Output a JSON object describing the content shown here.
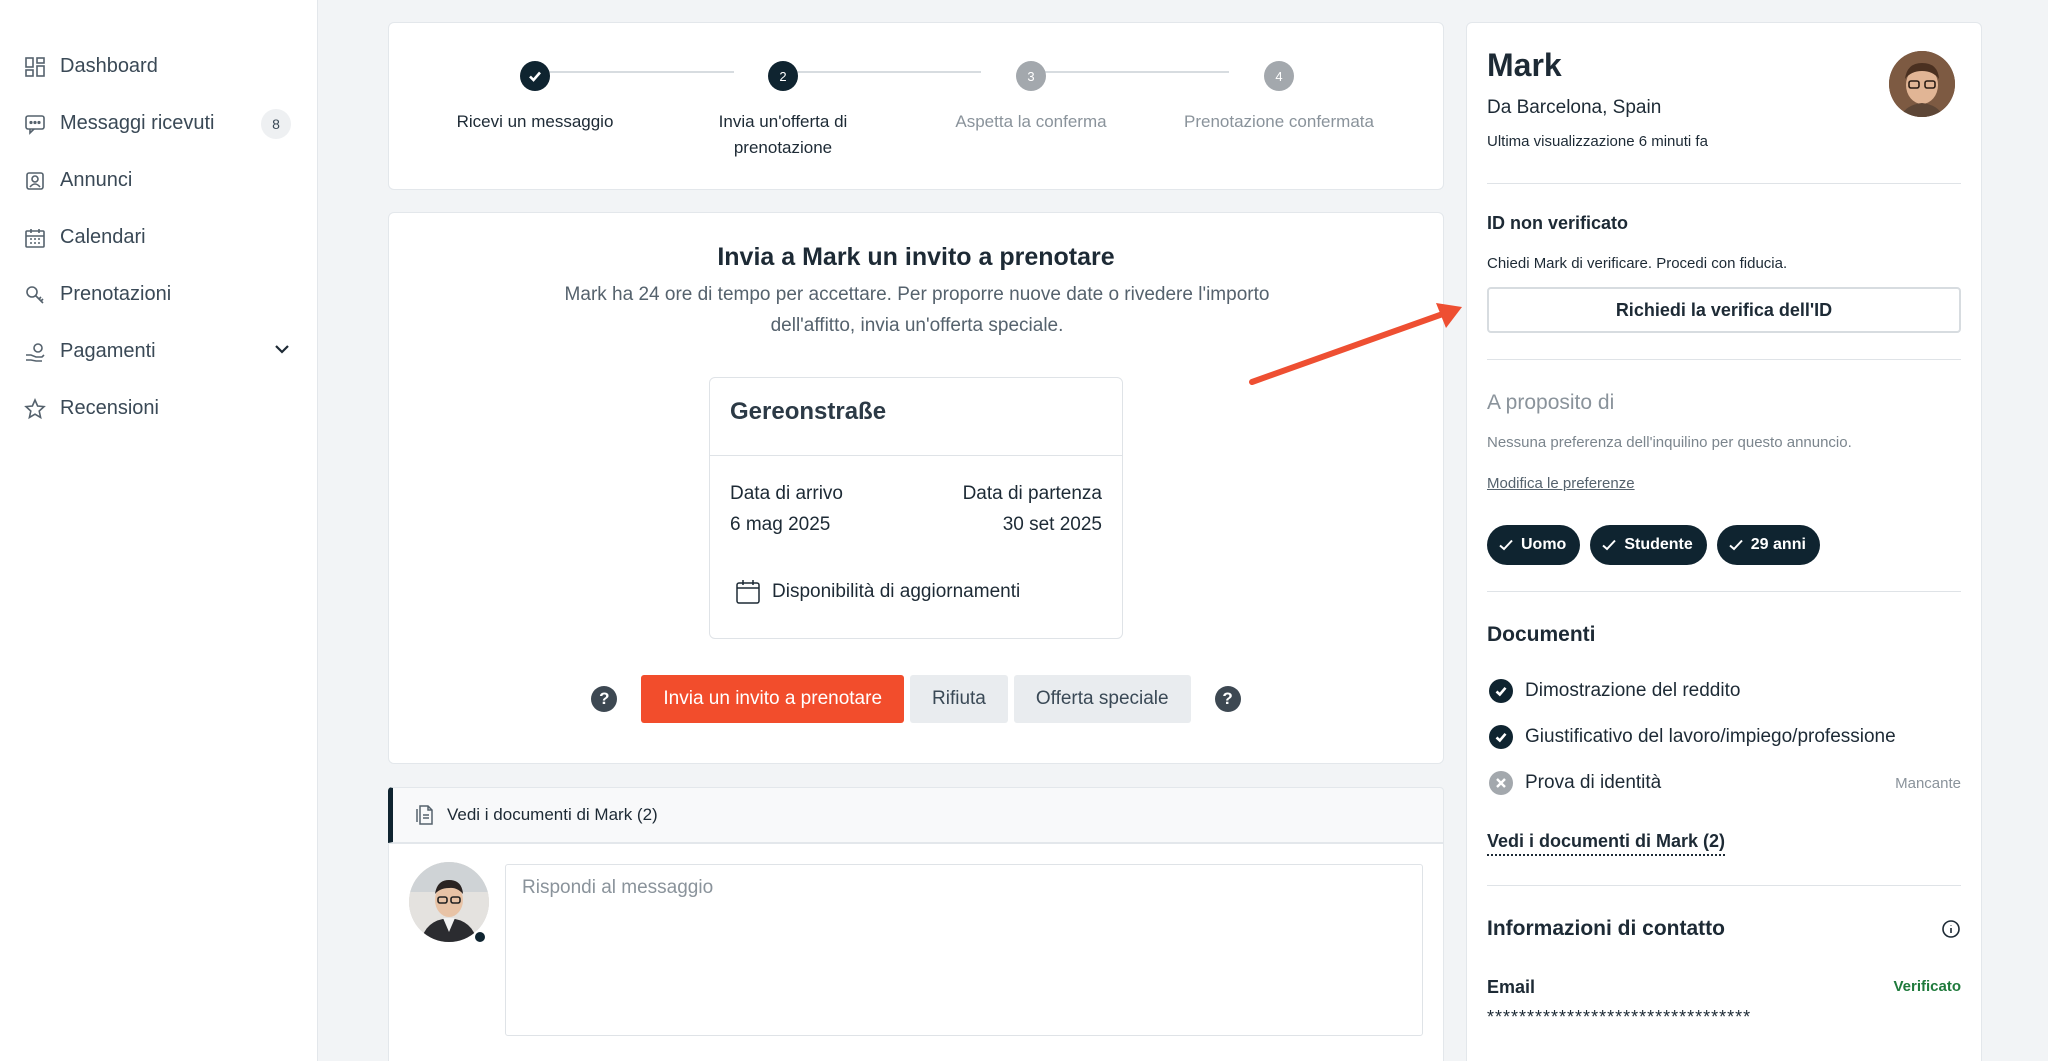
{
  "sidebar": {
    "items": [
      {
        "label": "Dashboard",
        "icon": "dashboard-icon"
      },
      {
        "label": "Messaggi ricevuti",
        "icon": "message-icon",
        "badge": "8"
      },
      {
        "label": "Annunci",
        "icon": "listing-icon"
      },
      {
        "label": "Calendari",
        "icon": "calendar-icon"
      },
      {
        "label": "Prenotazioni",
        "icon": "key-icon"
      },
      {
        "label": "Pagamenti",
        "icon": "payment-icon"
      },
      {
        "label": "Recensioni",
        "icon": "star-icon"
      }
    ]
  },
  "stepper": {
    "steps": [
      {
        "label": "Ricevi un messaggio",
        "number": "",
        "state": "done"
      },
      {
        "label": "Invia un'offerta di prenotazione",
        "number": "2",
        "state": "active"
      },
      {
        "label": "Aspetta la conferma",
        "number": "3",
        "state": "pending"
      },
      {
        "label": "Prenotazione confermata",
        "number": "4",
        "state": "pending"
      }
    ]
  },
  "invite": {
    "title": "Invia a Mark un invito a prenotare",
    "subtitle": "Mark ha 24 ore di tempo per accettare. Per proporre nuove date o rivedere l'importo dell'affitto, invia un'offerta speciale.",
    "property_name": "Gereonstraße",
    "arrival_label": "Data di arrivo",
    "arrival_value": "6 mag 2025",
    "departure_label": "Data di partenza",
    "departure_value": "30 set 2025",
    "availability_label": "Disponibilità di aggiornamenti",
    "help_left": "?",
    "help_right": "?",
    "btn_invite": "Invia un invito a prenotare",
    "btn_reject": "Rifiuta",
    "btn_special": "Offerta speciale"
  },
  "documents_bar": {
    "label": "Vedi i documenti di Mark (2)"
  },
  "reply": {
    "placeholder": "Rispondi al messaggio"
  },
  "profile": {
    "name": "Mark",
    "from": "Da Barcelona, Spain",
    "last_seen": "Ultima visualizzazione 6 minuti fa",
    "id_title": "ID non verificato",
    "id_text": "Chiedi Mark di verificare. Procedi con fiducia.",
    "verify_button": "Richiedi la verifica dell'ID",
    "about_title": "A proposito di",
    "about_text": "Nessuna preferenza dell'inquilino per questo annuncio.",
    "edit_prefs": "Modifica le preferenze",
    "chips": [
      "Uomo",
      "Studente",
      "29 anni"
    ],
    "documents_title": "Documenti",
    "documents": [
      {
        "label": "Dimostrazione del reddito",
        "status": "",
        "state": "ok"
      },
      {
        "label": "Giustificativo del lavoro/impiego/professione",
        "status": "",
        "state": "ok"
      },
      {
        "label": "Prova di identità",
        "status": "Mancante",
        "state": "missing"
      }
    ],
    "documents_link": "Vedi i documenti di Mark (2)",
    "contact_title": "Informazioni di contatto",
    "email_label": "Email",
    "email_status": "Verificato",
    "email_value": "*********************************"
  },
  "colors": {
    "accent": "#f24d2c",
    "dark": "#0f2430",
    "verified": "#1f7a3c"
  }
}
